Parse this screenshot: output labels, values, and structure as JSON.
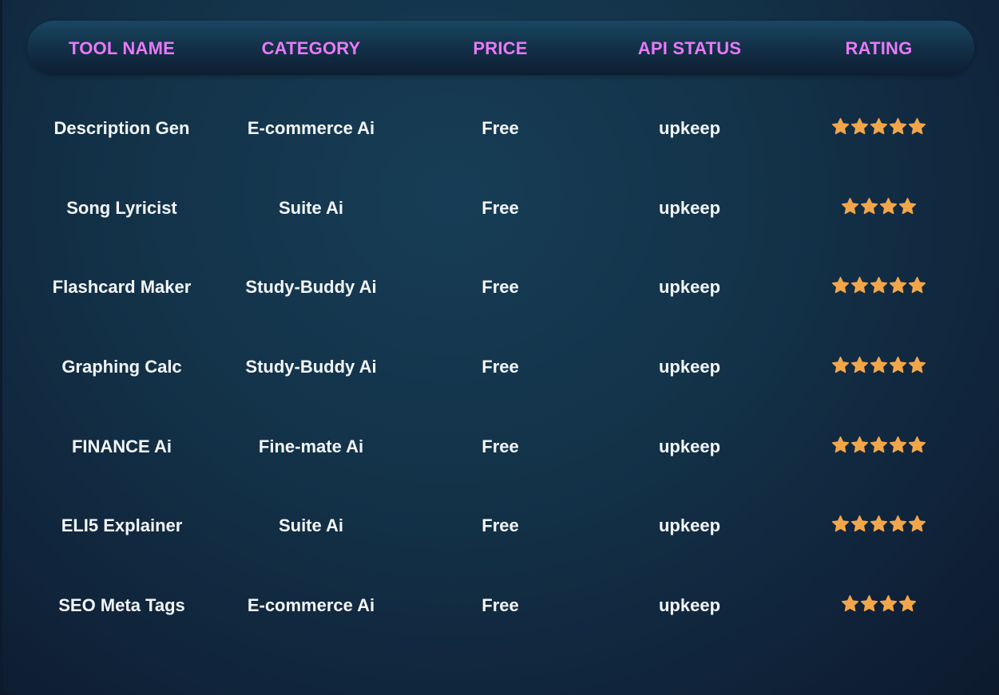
{
  "table": {
    "columns": [
      "TOOL NAME",
      "CATEGORY",
      "PRICE",
      "API STATUS",
      "RATING"
    ],
    "rows": [
      {
        "tool_name": "Description Gen",
        "category": "E-commerce Ai",
        "price": "Free",
        "api_status": "upkeep",
        "rating": 5
      },
      {
        "tool_name": "Song Lyricist",
        "category": "Suite Ai",
        "price": "Free",
        "api_status": "upkeep",
        "rating": 4
      },
      {
        "tool_name": "Flashcard Maker",
        "category": "Study-Buddy Ai",
        "price": "Free",
        "api_status": "upkeep",
        "rating": 5
      },
      {
        "tool_name": "Graphing Calc",
        "category": "Study-Buddy Ai",
        "price": "Free",
        "api_status": "upkeep",
        "rating": 5
      },
      {
        "tool_name": "FINANCE Ai",
        "category": "Fine-mate Ai",
        "price": "Free",
        "api_status": "upkeep",
        "rating": 5
      },
      {
        "tool_name": "ELI5 Explainer",
        "category": "Suite Ai",
        "price": "Free",
        "api_status": "upkeep",
        "rating": 5
      },
      {
        "tool_name": "SEO Meta Tags",
        "category": "E-commerce Ai",
        "price": "Free",
        "api_status": "upkeep",
        "rating": 4
      }
    ]
  },
  "colors": {
    "header_text": "#e879f9",
    "body_text": "#f3f6fa",
    "star": "#f2a64a"
  },
  "icons": {
    "rating": "star-icon"
  }
}
